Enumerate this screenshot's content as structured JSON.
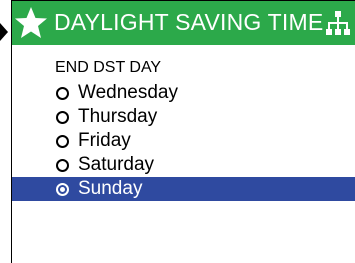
{
  "header": {
    "title": "DAYLIGHT SAVING TIME",
    "star_icon": "star-icon",
    "network_icon": "network-icon",
    "color": "#2ca94a"
  },
  "section_label": "END DST DAY",
  "options": [
    {
      "label": "Wednesday",
      "selected": false
    },
    {
      "label": "Thursday",
      "selected": false
    },
    {
      "label": "Friday",
      "selected": false
    },
    {
      "label": "Saturday",
      "selected": false
    },
    {
      "label": "Sunday",
      "selected": true
    }
  ],
  "selection_color": "#2f4aa0"
}
